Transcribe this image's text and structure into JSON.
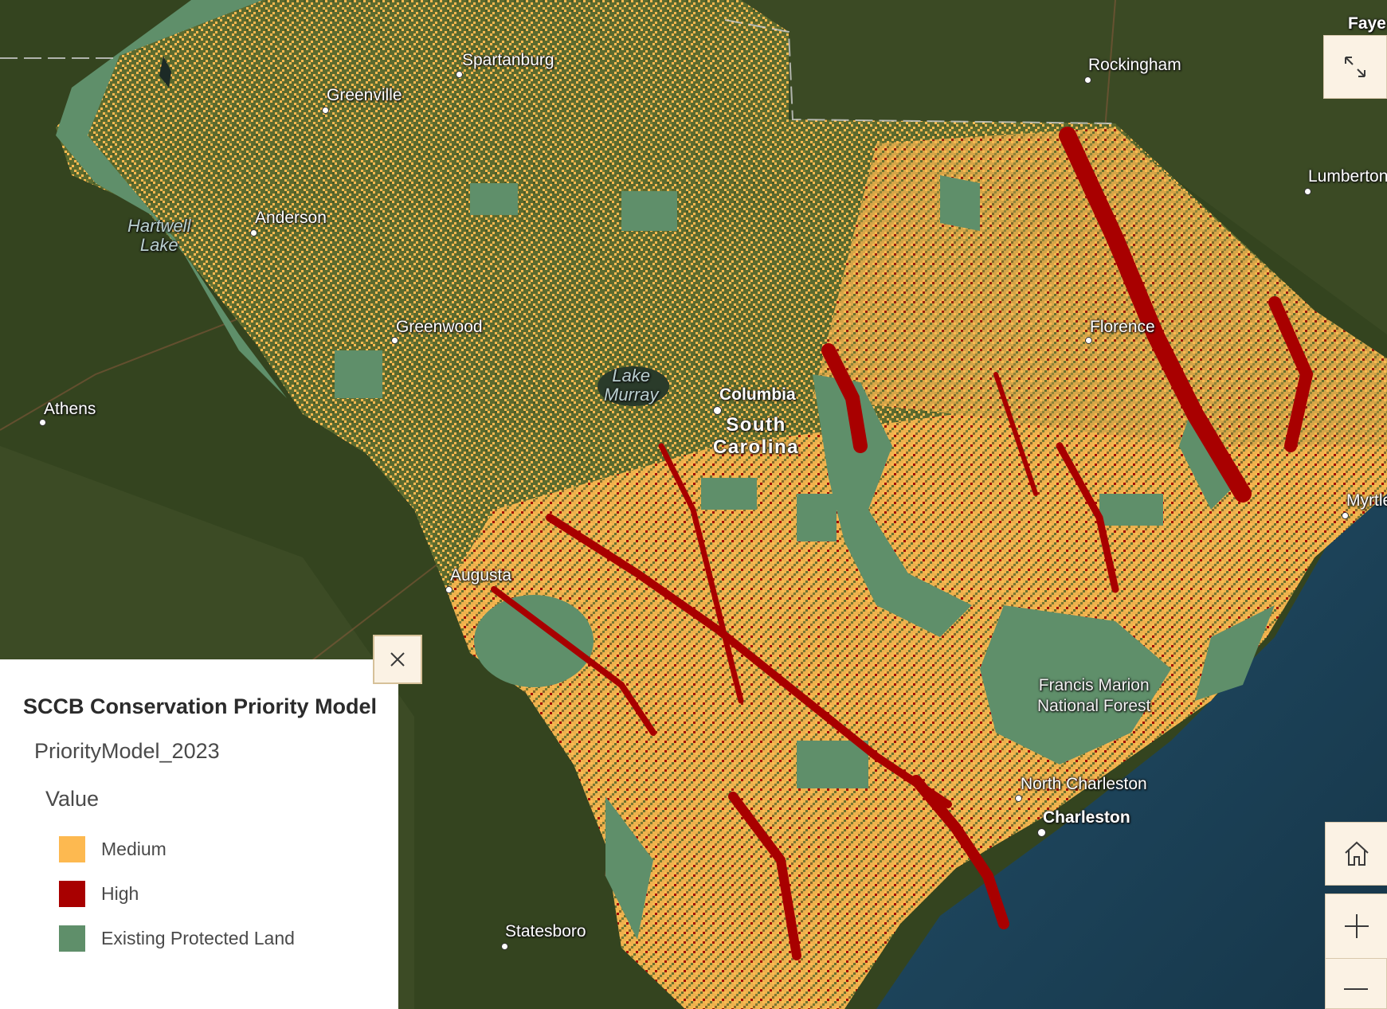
{
  "map": {
    "places": [
      {
        "id": "spartanburg",
        "name": "Spartanburg",
        "style": "normal"
      },
      {
        "id": "greenville",
        "name": "Greenville",
        "style": "normal"
      },
      {
        "id": "anderson",
        "name": "Anderson",
        "style": "normal"
      },
      {
        "id": "greenwood",
        "name": "Greenwood",
        "style": "normal"
      },
      {
        "id": "athens",
        "name": "Athens",
        "style": "normal"
      },
      {
        "id": "augusta",
        "name": "Augusta",
        "style": "normal"
      },
      {
        "id": "statesboro",
        "name": "Statesboro",
        "style": "normal"
      },
      {
        "id": "rockingham",
        "name": "Rockingham",
        "style": "normal"
      },
      {
        "id": "lumberton",
        "name": "Lumberton",
        "style": "normal"
      },
      {
        "id": "florence",
        "name": "Florence",
        "style": "normal"
      },
      {
        "id": "columbia",
        "name": "Columbia",
        "style": "bold"
      },
      {
        "id": "north-charleston",
        "name": "North Charleston",
        "style": "normal"
      },
      {
        "id": "charleston",
        "name": "Charleston",
        "style": "bold"
      },
      {
        "id": "myrtle",
        "name": "Myrtle",
        "style": "normal"
      },
      {
        "id": "faye",
        "name": "Faye",
        "style": "bold"
      }
    ],
    "state_label": {
      "line1": "South",
      "line2": "Carolina"
    },
    "water_labels": [
      {
        "id": "hartwell",
        "line1": "Hartwell",
        "line2": "Lake"
      },
      {
        "id": "murray",
        "line1": "Lake",
        "line2": "Murray"
      }
    ],
    "forest_label": {
      "line1": "Francis Marion",
      "line2": "National Forest"
    },
    "colors": {
      "medium": "#fdb950",
      "high": "#a80000",
      "protected": "#5f8f6a",
      "basemap_forest": "#3a4a22",
      "ocean": "#1f4560"
    }
  },
  "controls": {
    "expand_icon": "expand-icon",
    "home_icon": "home-icon",
    "zoom_in_icon": "plus-icon",
    "zoom_out_icon": "minus-icon",
    "close_icon": "close-icon"
  },
  "legend": {
    "title": "SCCB Conservation Priority Model",
    "layer": "PriorityModel_2023",
    "field": "Value",
    "items": [
      {
        "label": "Medium",
        "color": "#fdb950"
      },
      {
        "label": "High",
        "color": "#a80000"
      },
      {
        "label": "Existing Protected Land",
        "color": "#5f8f6a"
      }
    ]
  }
}
